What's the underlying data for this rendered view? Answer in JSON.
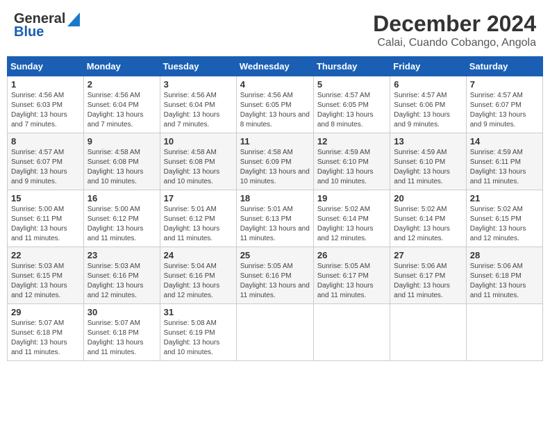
{
  "header": {
    "logo_general": "General",
    "logo_blue": "Blue",
    "main_title": "December 2024",
    "subtitle": "Calai, Cuando Cobango, Angola"
  },
  "weekdays": [
    "Sunday",
    "Monday",
    "Tuesday",
    "Wednesday",
    "Thursday",
    "Friday",
    "Saturday"
  ],
  "weeks": [
    [
      {
        "day": "1",
        "sunrise": "4:56 AM",
        "sunset": "6:03 PM",
        "daylight": "13 hours and 7 minutes."
      },
      {
        "day": "2",
        "sunrise": "4:56 AM",
        "sunset": "6:04 PM",
        "daylight": "13 hours and 7 minutes."
      },
      {
        "day": "3",
        "sunrise": "4:56 AM",
        "sunset": "6:04 PM",
        "daylight": "13 hours and 7 minutes."
      },
      {
        "day": "4",
        "sunrise": "4:56 AM",
        "sunset": "6:05 PM",
        "daylight": "13 hours and 8 minutes."
      },
      {
        "day": "5",
        "sunrise": "4:57 AM",
        "sunset": "6:05 PM",
        "daylight": "13 hours and 8 minutes."
      },
      {
        "day": "6",
        "sunrise": "4:57 AM",
        "sunset": "6:06 PM",
        "daylight": "13 hours and 9 minutes."
      },
      {
        "day": "7",
        "sunrise": "4:57 AM",
        "sunset": "6:07 PM",
        "daylight": "13 hours and 9 minutes."
      }
    ],
    [
      {
        "day": "8",
        "sunrise": "4:57 AM",
        "sunset": "6:07 PM",
        "daylight": "13 hours and 9 minutes."
      },
      {
        "day": "9",
        "sunrise": "4:58 AM",
        "sunset": "6:08 PM",
        "daylight": "13 hours and 10 minutes."
      },
      {
        "day": "10",
        "sunrise": "4:58 AM",
        "sunset": "6:08 PM",
        "daylight": "13 hours and 10 minutes."
      },
      {
        "day": "11",
        "sunrise": "4:58 AM",
        "sunset": "6:09 PM",
        "daylight": "13 hours and 10 minutes."
      },
      {
        "day": "12",
        "sunrise": "4:59 AM",
        "sunset": "6:10 PM",
        "daylight": "13 hours and 10 minutes."
      },
      {
        "day": "13",
        "sunrise": "4:59 AM",
        "sunset": "6:10 PM",
        "daylight": "13 hours and 11 minutes."
      },
      {
        "day": "14",
        "sunrise": "4:59 AM",
        "sunset": "6:11 PM",
        "daylight": "13 hours and 11 minutes."
      }
    ],
    [
      {
        "day": "15",
        "sunrise": "5:00 AM",
        "sunset": "6:11 PM",
        "daylight": "13 hours and 11 minutes."
      },
      {
        "day": "16",
        "sunrise": "5:00 AM",
        "sunset": "6:12 PM",
        "daylight": "13 hours and 11 minutes."
      },
      {
        "day": "17",
        "sunrise": "5:01 AM",
        "sunset": "6:12 PM",
        "daylight": "13 hours and 11 minutes."
      },
      {
        "day": "18",
        "sunrise": "5:01 AM",
        "sunset": "6:13 PM",
        "daylight": "13 hours and 11 minutes."
      },
      {
        "day": "19",
        "sunrise": "5:02 AM",
        "sunset": "6:14 PM",
        "daylight": "13 hours and 12 minutes."
      },
      {
        "day": "20",
        "sunrise": "5:02 AM",
        "sunset": "6:14 PM",
        "daylight": "13 hours and 12 minutes."
      },
      {
        "day": "21",
        "sunrise": "5:02 AM",
        "sunset": "6:15 PM",
        "daylight": "13 hours and 12 minutes."
      }
    ],
    [
      {
        "day": "22",
        "sunrise": "5:03 AM",
        "sunset": "6:15 PM",
        "daylight": "13 hours and 12 minutes."
      },
      {
        "day": "23",
        "sunrise": "5:03 AM",
        "sunset": "6:16 PM",
        "daylight": "13 hours and 12 minutes."
      },
      {
        "day": "24",
        "sunrise": "5:04 AM",
        "sunset": "6:16 PM",
        "daylight": "13 hours and 12 minutes."
      },
      {
        "day": "25",
        "sunrise": "5:05 AM",
        "sunset": "6:16 PM",
        "daylight": "13 hours and 11 minutes."
      },
      {
        "day": "26",
        "sunrise": "5:05 AM",
        "sunset": "6:17 PM",
        "daylight": "13 hours and 11 minutes."
      },
      {
        "day": "27",
        "sunrise": "5:06 AM",
        "sunset": "6:17 PM",
        "daylight": "13 hours and 11 minutes."
      },
      {
        "day": "28",
        "sunrise": "5:06 AM",
        "sunset": "6:18 PM",
        "daylight": "13 hours and 11 minutes."
      }
    ],
    [
      {
        "day": "29",
        "sunrise": "5:07 AM",
        "sunset": "6:18 PM",
        "daylight": "13 hours and 11 minutes."
      },
      {
        "day": "30",
        "sunrise": "5:07 AM",
        "sunset": "6:18 PM",
        "daylight": "13 hours and 11 minutes."
      },
      {
        "day": "31",
        "sunrise": "5:08 AM",
        "sunset": "6:19 PM",
        "daylight": "13 hours and 10 minutes."
      },
      null,
      null,
      null,
      null
    ]
  ]
}
